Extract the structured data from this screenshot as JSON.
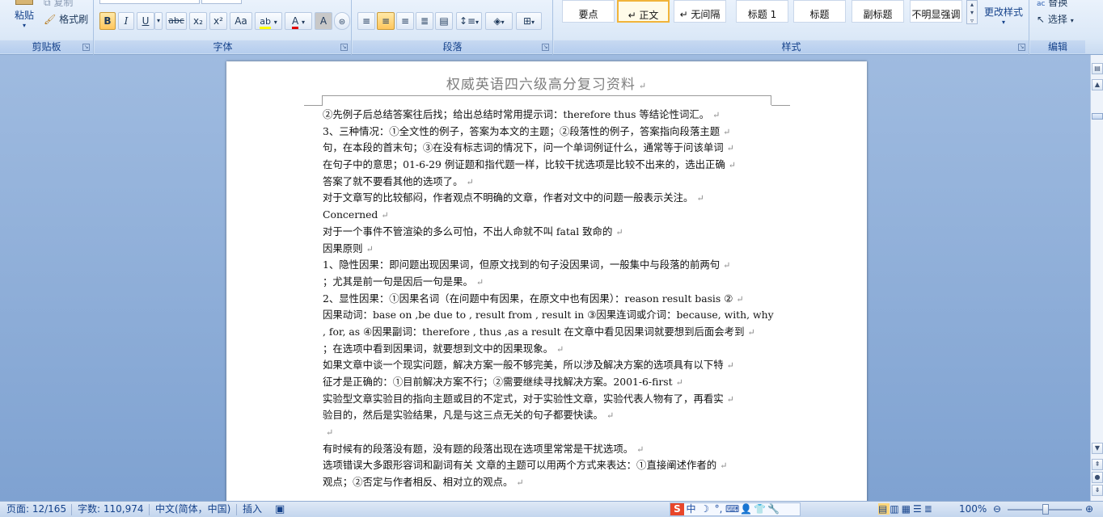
{
  "ribbon": {
    "clipboard": {
      "paste_label": "粘贴",
      "copy_label": "复制",
      "format_painter_label": "格式刷",
      "group_label": "剪贴板"
    },
    "font": {
      "group_label": "字体",
      "bold": "B",
      "italic": "I",
      "underline": "U",
      "strikethrough": "abc",
      "subscript": "x₂",
      "superscript": "x²",
      "change_case": "Aa",
      "highlight": "ab",
      "font_color": "A",
      "char_shading": "A",
      "enclose": "字"
    },
    "paragraph": {
      "group_label": "段落"
    },
    "styles": {
      "group_label": "样式",
      "items": [
        {
          "label": "要点",
          "active": false
        },
        {
          "label": "↵ 正文",
          "active": true
        },
        {
          "label": "↵ 无间隔",
          "active": false
        },
        {
          "label": "标题 1",
          "active": false
        },
        {
          "label": "标题",
          "active": false
        },
        {
          "label": "副标题",
          "active": false
        },
        {
          "label": "不明显强调",
          "active": false
        }
      ],
      "change_styles_label": "更改样式"
    },
    "editing": {
      "group_label": "编辑",
      "replace_label": "替换",
      "select_label": "选择"
    }
  },
  "document": {
    "header_title": "权威英语四六级高分复习资料",
    "lines": [
      "②先例子后总结答案往后找；给出总结时常用提示词：therefore thus 等结论性词汇。",
      "3、三种情况：①全文性的例子，答案为本文的主题；②段落性的例子，答案指向段落主题",
      "句，在本段的首末句；③在没有标志词的情况下，问一个单词例证什么，通常等于问该单词",
      "在句子中的意思；01-6-29 例证题和指代题一样，比较干扰选项是比较不出来的，选出正确",
      "答案了就不要看其他的选项了。",
      "对于文章写的比较郁闷，作者观点不明确的文章，作者对文中的问题一般表示关注。",
      "Concerned",
      "对于一个事件不管渲染的多么可怕，不出人命就不叫  fatal  致命的",
      "因果原则",
      "1、隐性因果：即问题出现因果词，但原文找到的句子没因果词，一般集中与段落的前两句",
      "；尤其是前一句是因后一句是果。",
      "2、显性因果：①因果名词（在问题中有因果，在原文中也有因果）：reason result basis  ②",
      "因果动词：base on ,be due to , result from , result in  ③因果连词或介词：because,  with, why",
      ", for, as ④因果副词：therefore , thus ,as a result  在文章中看见因果词就要想到后面会考到",
      "；在选项中看到因果词，就要想到文中的因果现象。",
      "如果文章中谈一个现实问题，解决方案一般不够完美，所以涉及解决方案的选项具有以下特",
      "征才是正确的：①目前解决方案不行；②需要继续寻找解决方案。2001-6-first",
      "实验型文章实验目的指向主题或目的不定式，对于实验性文章，实验代表人物有了，再看实",
      "验目的，然后是实验结果，凡是与这三点无关的句子都要快读。",
      "",
      "有时候有的段落没有题，没有题的段落出现在选项里常常是干扰选项。",
      "选项错误大多跟形容词和副词有关  文章的主题可以用两个方式来表达：①直接阐述作者的",
      "观点；②否定与作者相反、相对立的观点。"
    ]
  },
  "status_bar": {
    "page": "页面: 12/165",
    "words": "字数: 110,974",
    "language": "中文(简体，中国)",
    "mode": "插入",
    "zoom": "100%",
    "ime_chars": [
      "S",
      "中",
      "☽",
      "°,",
      "⌨",
      "👤",
      "👕",
      "🔧"
    ]
  },
  "colors": {
    "ribbon_bg": "#dbe8f7",
    "group_label": "#15428b",
    "active_style_border": "#f1b43a",
    "doc_bg": "#8fb0dc"
  }
}
